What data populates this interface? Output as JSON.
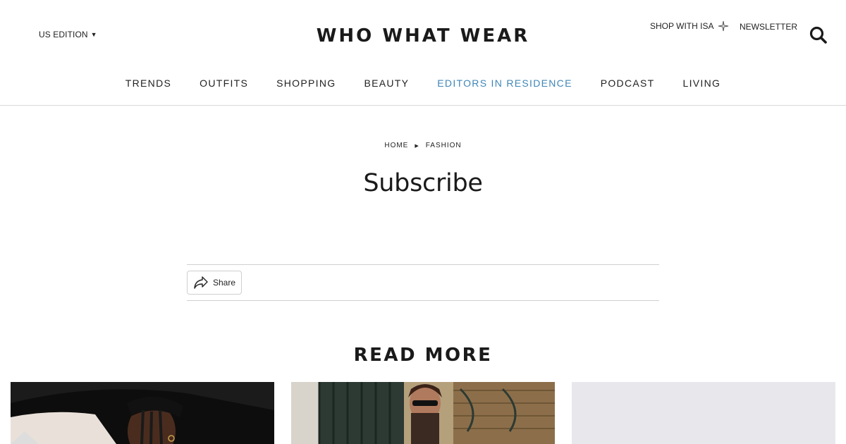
{
  "header": {
    "edition_label": "US EDITION",
    "logo_text": "WHO WHAT WEAR",
    "shop_label": "SHOP WITH ISA",
    "newsletter_label": "NEWSLETTER"
  },
  "nav": {
    "items": [
      {
        "label": "TRENDS"
      },
      {
        "label": "OUTFITS"
      },
      {
        "label": "SHOPPING"
      },
      {
        "label": "BEAUTY"
      },
      {
        "label": "EDITORS IN RESIDENCE"
      },
      {
        "label": "PODCAST"
      },
      {
        "label": "LIVING"
      }
    ],
    "active_color": "#3f86b7"
  },
  "breadcrumb": {
    "items": [
      {
        "label": "HOME"
      },
      {
        "label": "FASHION"
      }
    ]
  },
  "page": {
    "title": "Subscribe"
  },
  "share": {
    "label": "Share"
  },
  "read_more": {
    "heading": "READ MORE"
  },
  "icons": {
    "search": "search-icon",
    "share": "share-arrow-icon",
    "sparkle": "sparkle-icon",
    "caret": "caret-down-icon",
    "breadcrumb_separator": "triangle-right-icon"
  }
}
